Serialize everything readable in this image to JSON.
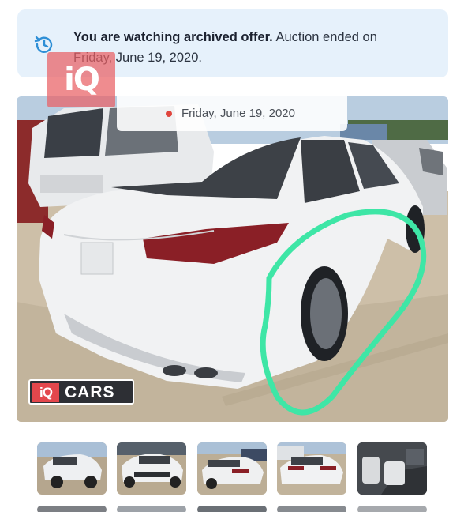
{
  "banner": {
    "icon": "history-icon",
    "bold_text": "You are watching archived offer.",
    "normal_text": " Auction ended on Friday, June 19, 2020."
  },
  "watermark": {
    "text": "iQ"
  },
  "gallery": {
    "date_label": "Friday, June 19, 2020",
    "brand": {
      "iq": "iQ",
      "cars": "CARS"
    }
  },
  "thumbnails": [
    {
      "name": "front-left view"
    },
    {
      "name": "front view"
    },
    {
      "name": "rear-left view"
    },
    {
      "name": "rear view"
    },
    {
      "name": "interior view"
    }
  ],
  "colors": {
    "banner_bg": "#e6f1fb",
    "accent_blue": "#2e8fd6",
    "highlight_green": "#3ee6a6",
    "brand_red": "#e3474c"
  }
}
